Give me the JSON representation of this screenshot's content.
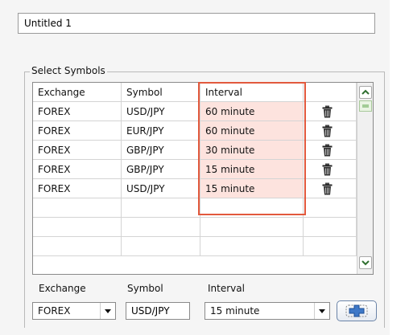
{
  "document": {
    "title_value": "Untitled 1"
  },
  "group": {
    "legend": "Select Symbols"
  },
  "table": {
    "columns": [
      "Exchange",
      "Symbol",
      "Interval",
      ""
    ],
    "rows": [
      {
        "exchange": "FOREX",
        "symbol": "USD/JPY",
        "interval": "60 minute"
      },
      {
        "exchange": "FOREX",
        "symbol": "EUR/JPY",
        "interval": "60 minute"
      },
      {
        "exchange": "FOREX",
        "symbol": "GBP/JPY",
        "interval": "30 minute"
      },
      {
        "exchange": "FOREX",
        "symbol": "GBP/JPY",
        "interval": "15 minute"
      },
      {
        "exchange": "FOREX",
        "symbol": "USD/JPY",
        "interval": "15 minute"
      }
    ],
    "empty_rows": 3
  },
  "form": {
    "exchange_label": "Exchange",
    "symbol_label": "Symbol",
    "interval_label": "Interval",
    "exchange_value": "FOREX",
    "symbol_value": "USD/JPY",
    "interval_value": "15 minute"
  },
  "icons": {
    "delete": "trash-icon",
    "scroll_up": "chevron-up-icon",
    "scroll_down": "chevron-down-icon",
    "dropdown": "caret-down-icon",
    "add": "plus-icon"
  },
  "colors": {
    "highlight_border": "#e2593d",
    "interval_fill": "#fde3de",
    "scroll_arrow": "#2f6f2f",
    "add_icon": "#3e78c8"
  }
}
